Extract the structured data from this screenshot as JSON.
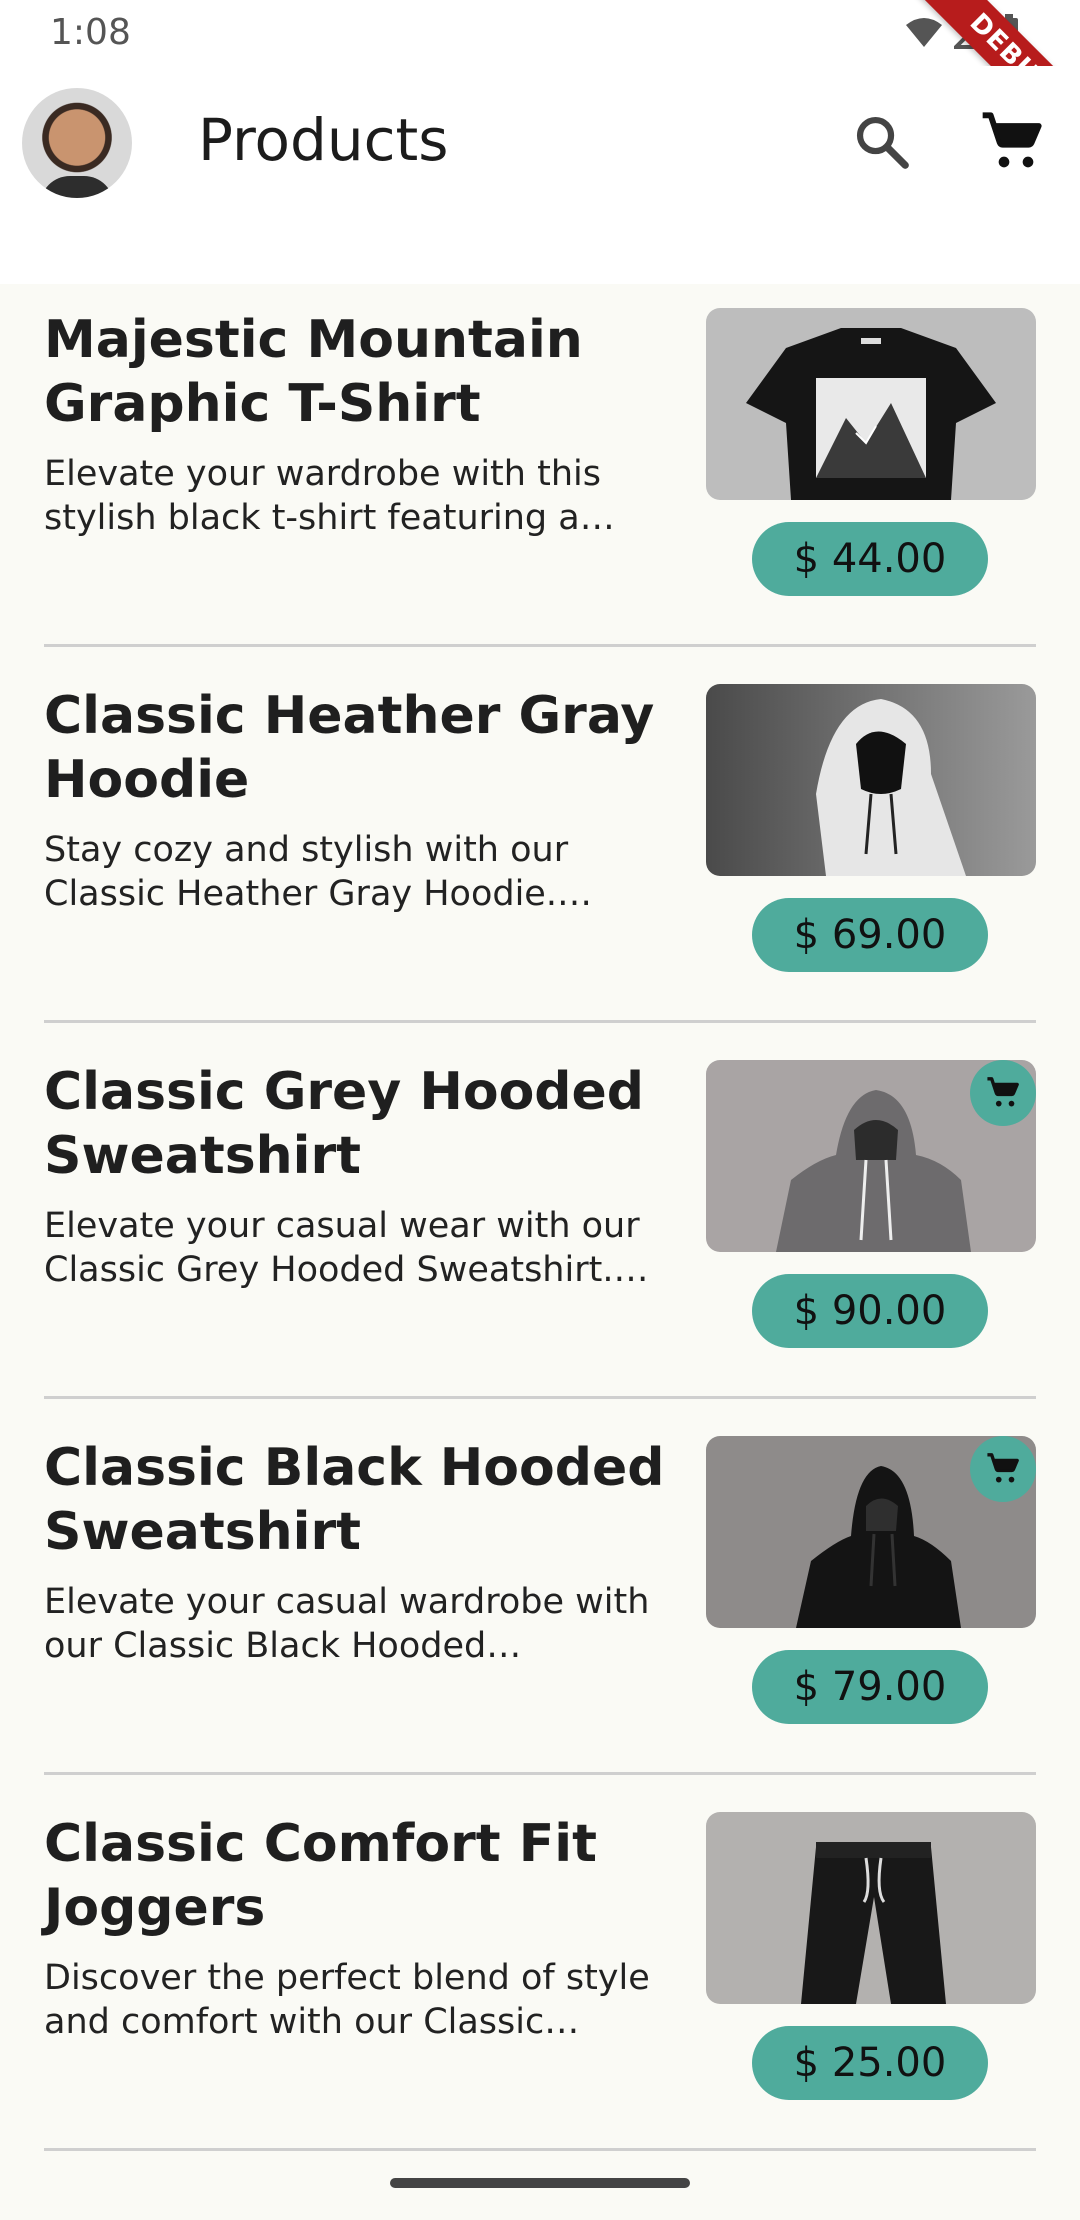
{
  "status_bar": {
    "time": "1:08",
    "debug_label": "DEBUG"
  },
  "app_bar": {
    "title": "Products",
    "search_icon": "search-icon",
    "cart_icon": "cart-icon"
  },
  "products": [
    {
      "title": "Majestic Mountain Graphic T-Shirt",
      "description": "Elevate your wardrobe with this stylish black t-shirt featuring a striking",
      "price": "$ 44.00",
      "in_cart": false,
      "image": "black-tshirt-mountain"
    },
    {
      "title": "Classic Heather Gray Hoodie",
      "description": "Stay cozy and stylish with our Classic Heather Gray Hoodie. Crafted",
      "price": "$ 69.00",
      "in_cart": false,
      "image": "white-hoodie"
    },
    {
      "title": "Classic Grey Hooded Sweatshirt",
      "description": "Elevate your casual wear with our Classic Grey Hooded Sweatshirt. Made",
      "price": "$ 90.00",
      "in_cart": true,
      "image": "grey-hoodie"
    },
    {
      "title": "Classic Black Hooded Sweatshirt",
      "description": "Elevate your casual wardrobe with our Classic Black Hooded Sweatshirt",
      "price": "$ 79.00",
      "in_cart": true,
      "image": "black-hoodie"
    },
    {
      "title": "Classic Comfort Fit Joggers",
      "description": "Discover the perfect blend of style and comfort with our Classic Comfort",
      "price": "$ 25.00",
      "in_cart": false,
      "image": "black-joggers"
    }
  ],
  "colors": {
    "accent": "#4fab9c",
    "background": "#fafaf5",
    "debug": "#b71c1c"
  }
}
